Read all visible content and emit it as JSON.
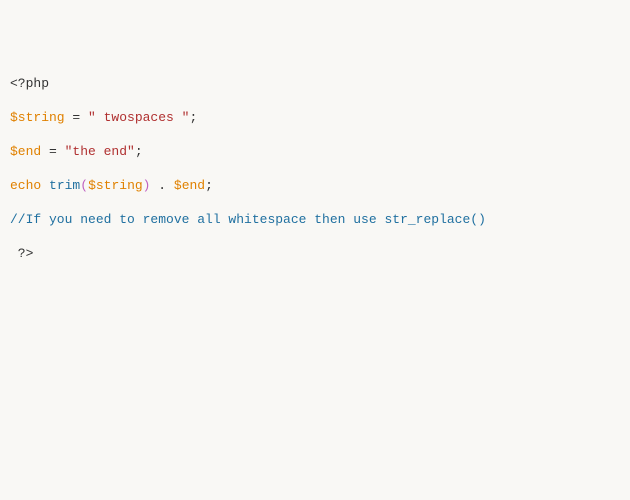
{
  "code": {
    "line1": {
      "open": "<?php"
    },
    "line2": {
      "var": "$string",
      "eq": " = ",
      "str": "\" twospaces \"",
      "semi": ";"
    },
    "line3": {
      "var": "$end",
      "eq": " = ",
      "str": "\"the end\"",
      "semi": ";"
    },
    "line4": {
      "echo": "echo",
      "sp1": " ",
      "func": "trim",
      "lparen": "(",
      "arg": "$string",
      "rparen": ")",
      "concat": " . ",
      "var2": "$end",
      "semi": ";"
    },
    "line5": {
      "comment": "//If you need to remove all whitespace then use str_replace()"
    },
    "line6": {
      "close": " ?>"
    }
  }
}
